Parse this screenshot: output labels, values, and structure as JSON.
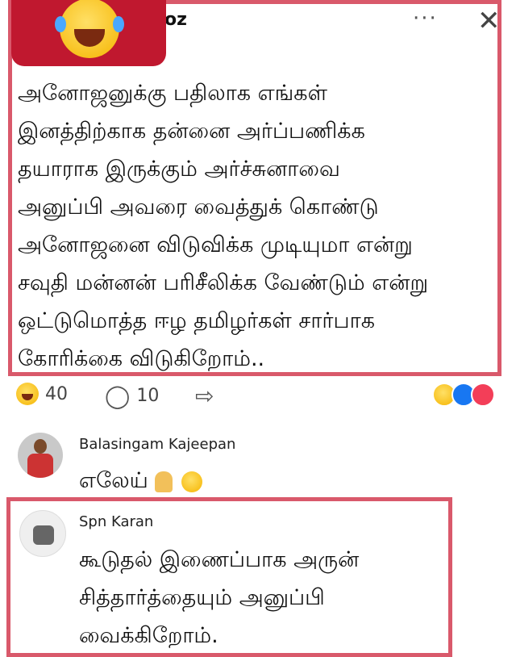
{
  "post": {
    "author_suffix": "oz",
    "more_label": "···",
    "close_label": "✕",
    "lines": [
      "அனோஜனுக்கு பதிலாக எங்கள்",
      "இனத்திற்காக தன்னை அர்ப்பணிக்க",
      "தயாராக இருக்கும் அர்ச்சுனாவை",
      "அனுப்பி அவரை வைத்துக் கொண்டு",
      "அனோஜனை விடுவிக்க முடியுமா என்று",
      "சவுதி மன்னன் பரிசீலிக்க வேண்டும் என்று",
      "ஒட்டுமொத்த ஈழ தமிழர்கள் சார்பாக",
      "கோரிக்கை விடுகிறோம்.."
    ]
  },
  "reactions": {
    "laugh_count": "40",
    "comment_count": "10",
    "comment_icon": "comment-icon",
    "share_icon": "share-icon"
  },
  "comments": [
    {
      "name": "Balasingam Kajeepan",
      "text": "எலேய்"
    },
    {
      "name": "Spn Karan",
      "lines": [
        "கூடுதல் இணைப்பாக அருன்",
        "சித்தார்த்தையும் அனுப்பி",
        "வைக்கிறோம்."
      ]
    }
  ],
  "colors": {
    "highlight_border": "#d9596b",
    "overlay_red": "#c0182f",
    "like_blue": "#1877f2",
    "love_red": "#f33e58"
  }
}
